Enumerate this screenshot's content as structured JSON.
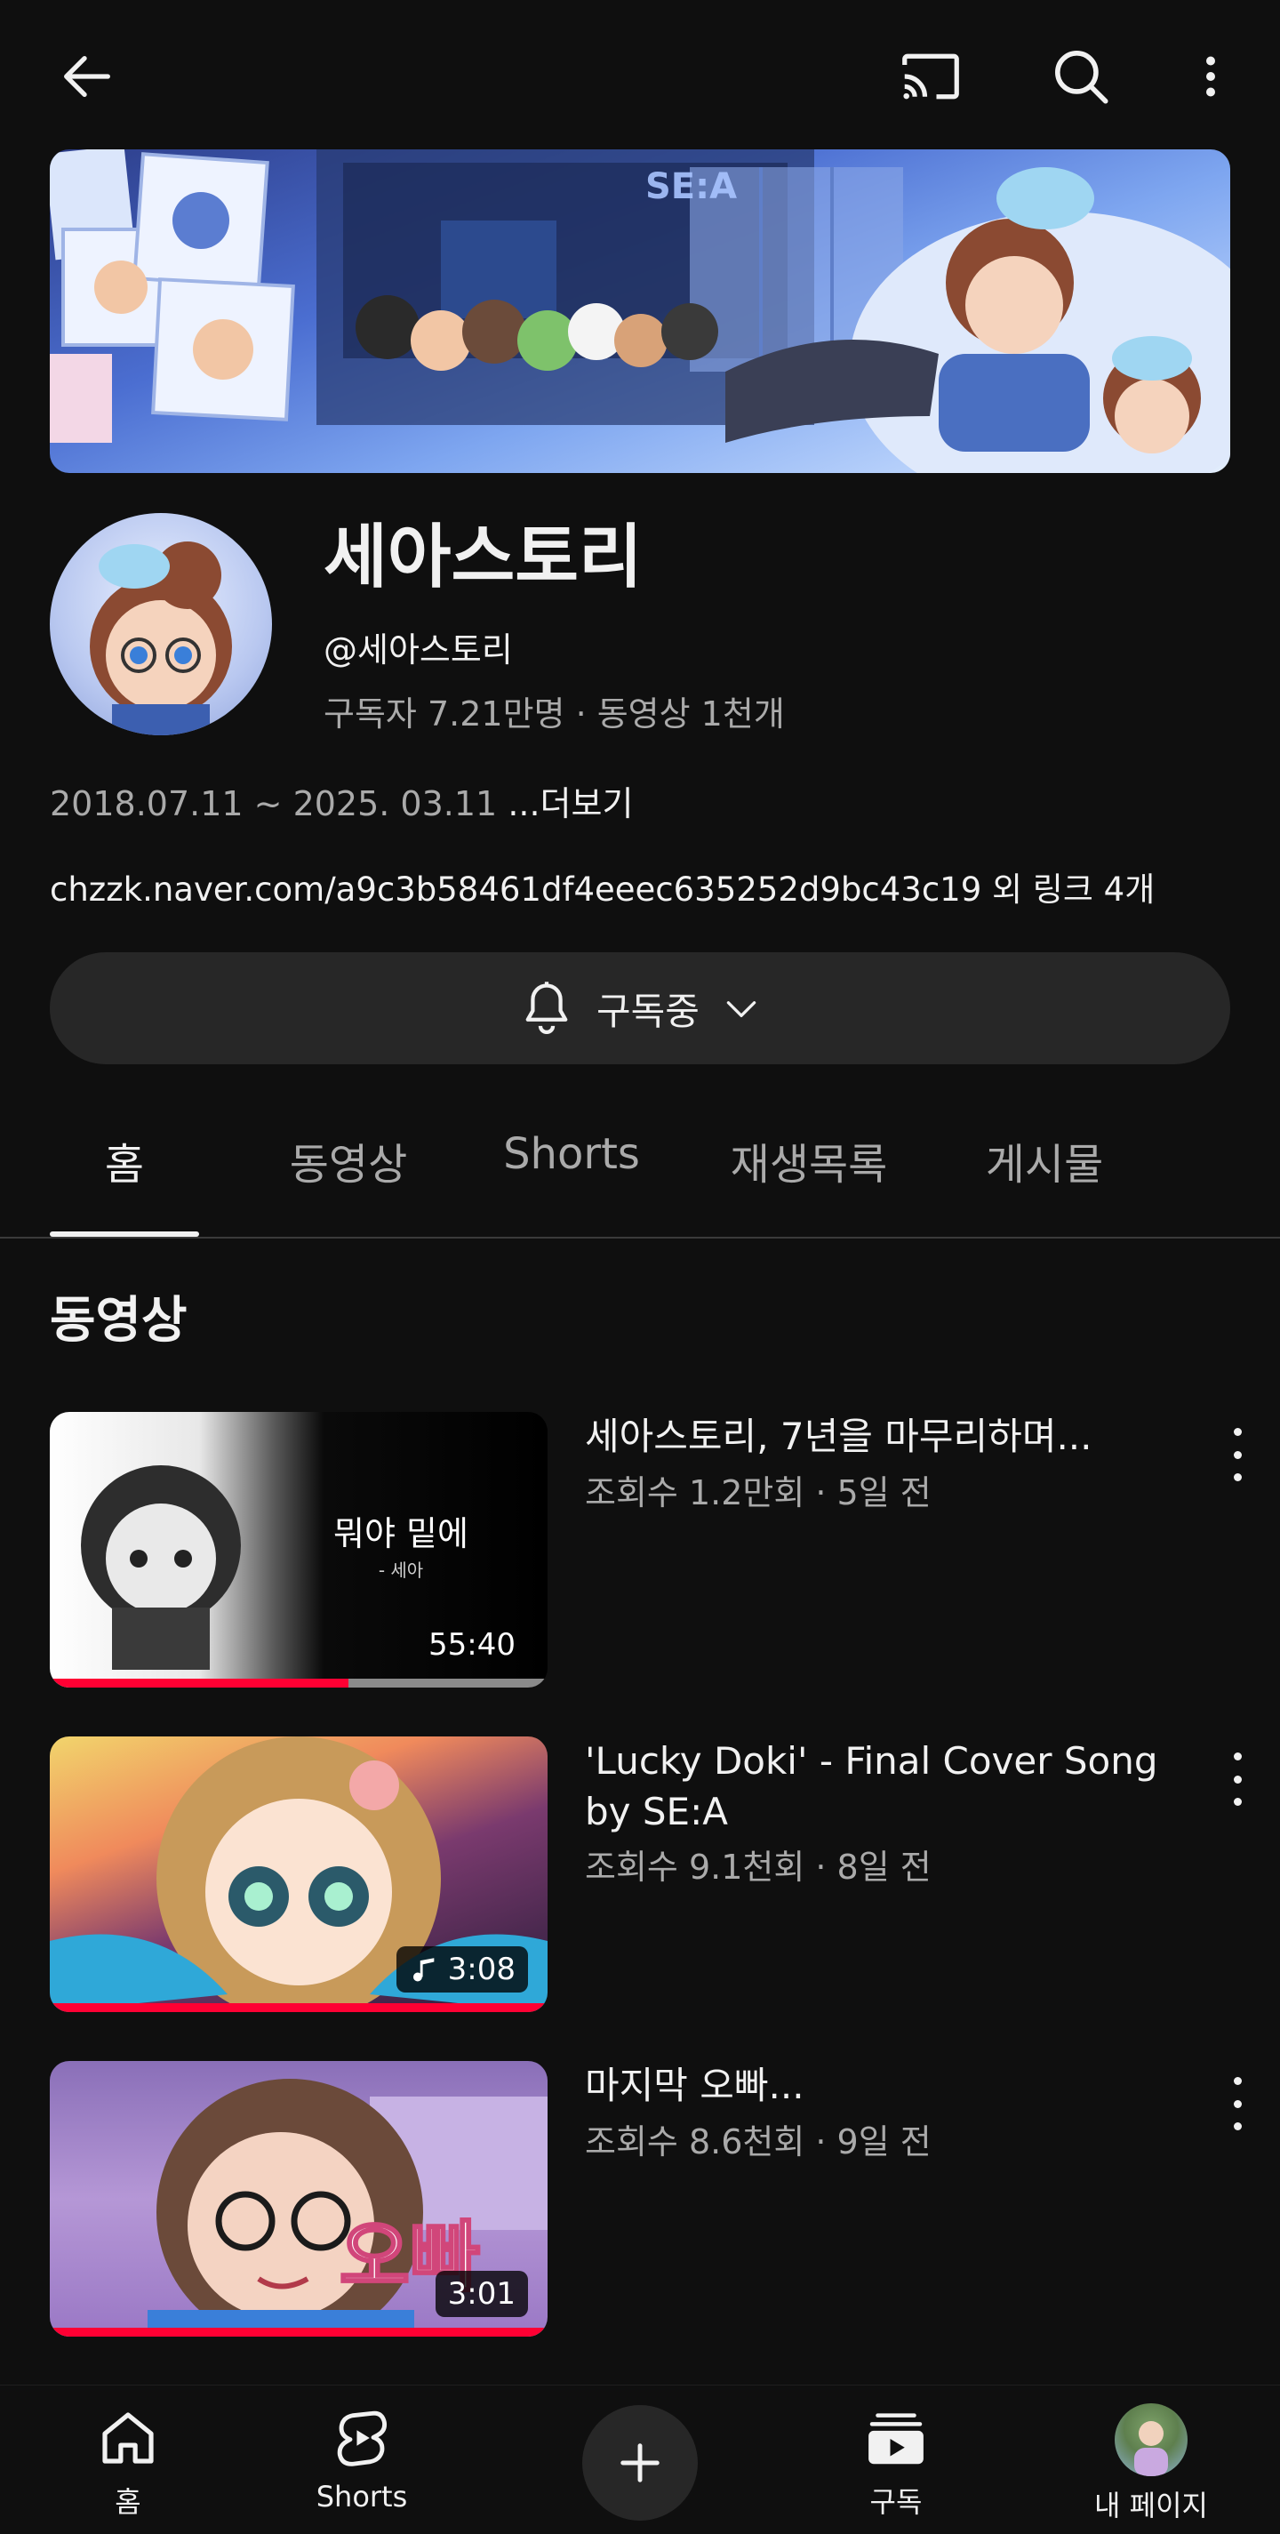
{
  "channel": {
    "name": "세아스토리",
    "handle": "@세아스토리",
    "stats": "구독자 7.21만명 · 동영상 1천개",
    "dates": "2018.07.11 ~ 2025. 03.11 ",
    "more_label": "...더보기",
    "link_text": "chzzk.naver.com/a9c3b58461df4eeec635252d9bc43c19 외 링크 4개",
    "banner_logo": "SE:A"
  },
  "subscribe": {
    "label": "구독중",
    "icon": "bell-icon"
  },
  "tabs": [
    {
      "label": "홈",
      "active": true
    },
    {
      "label": "동영상",
      "active": false
    },
    {
      "label": "Shorts",
      "active": false
    },
    {
      "label": "재생목록",
      "active": false
    },
    {
      "label": "게시물",
      "active": false
    }
  ],
  "section_title": "동영상",
  "videos": [
    {
      "title": "세아스토리, 7년을 마무리하며...",
      "meta": "조회수 1.2만회 · 5일 전",
      "duration": "55:40",
      "thumb_text": "뭐야 밑에",
      "thumb_subtext": "- 세아",
      "progress": 0.6
    },
    {
      "title": "'Lucky Doki' - Final Cover Song by SE:A",
      "meta": "조회수 9.1천회 · 8일 전",
      "duration": "3:08",
      "music_icon": "music-note-icon",
      "progress": 1.0
    },
    {
      "title": "마지막 오빠...",
      "meta": "조회수 8.6천회 · 9일 전",
      "duration": "3:01",
      "thumb_text": "오빠",
      "progress": 1.0
    }
  ],
  "bottom_nav": [
    {
      "label": "홈",
      "icon": "home-icon"
    },
    {
      "label": "Shorts",
      "icon": "shorts-icon"
    },
    {
      "label": "",
      "icon": "plus-icon"
    },
    {
      "label": "구독",
      "icon": "subscriptions-icon"
    },
    {
      "label": "내 페이지",
      "icon": "avatar-icon"
    }
  ],
  "colors": {
    "background": "#0f0f0f",
    "accent_red": "#ff0033",
    "muted_text": "#aaaaaa",
    "chip_bg": "#272727"
  }
}
